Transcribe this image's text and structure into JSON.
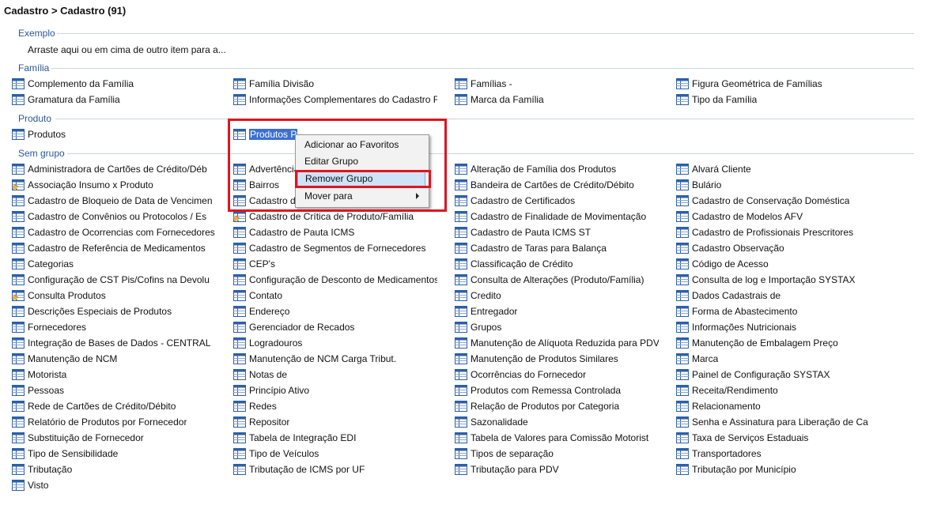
{
  "title": "Cadastro > Cadastro (91)",
  "colors": {
    "group": "#2b5797",
    "icon": "#2e5fa8",
    "selection": "#3a6fcf",
    "annotation": "#e0141e"
  },
  "groups": {
    "exemplo": "Exemplo",
    "familia": "Família",
    "produto": "Produto",
    "sem_grupo": "Sem grupo"
  },
  "hint": "Arraste aqui ou em cima de outro item para a...",
  "familia_items": [
    {
      "label": "Complemento da Família",
      "icon": "table-icon"
    },
    {
      "label": "Família Divisão",
      "icon": "table-icon"
    },
    {
      "label": "Famílias -",
      "icon": "table-icon"
    },
    {
      "label": "Figura Geométrica de Famílias",
      "icon": "table-icon"
    },
    {
      "label": "Gramatura da Família",
      "icon": "table-icon"
    },
    {
      "label": "Informações Complementares do Cadastro F",
      "icon": "table-icon"
    },
    {
      "label": "Marca da Família",
      "icon": "table-icon"
    },
    {
      "label": "Tipo da Família",
      "icon": "table-icon"
    }
  ],
  "produto_items": [
    {
      "label": "Produtos",
      "icon": "table-icon"
    },
    {
      "label": "Produtos P",
      "icon": "table-icon",
      "selected": true
    }
  ],
  "sem_grupo_items": [
    {
      "label": "Administradora de Cartões de Crédito/Déb",
      "icon": "table-icon"
    },
    {
      "label": "Advertência",
      "icon": "table-icon"
    },
    {
      "label": "Alteração de Família dos Produtos",
      "icon": "table-icon"
    },
    {
      "label": "Alvará Cliente",
      "icon": "table-icon"
    },
    {
      "label": "Associação Insumo x Produto",
      "icon": "table-star-icon"
    },
    {
      "label": "Bairros",
      "icon": "table-icon"
    },
    {
      "label": "Bandeira de Cartões de Crédito/Débito",
      "icon": "table-icon"
    },
    {
      "label": "Bulário",
      "icon": "table-icon"
    },
    {
      "label": "Cadastro de Bloqueio de Data de Vencimen",
      "icon": "table-icon"
    },
    {
      "label": "Cadastro de",
      "icon": "table-icon"
    },
    {
      "label": "Cadastro de Certificados",
      "icon": "table-icon"
    },
    {
      "label": "Cadastro de Conservação Doméstica",
      "icon": "table-icon"
    },
    {
      "label": "Cadastro de Convênios ou Protocolos / Es",
      "icon": "table-icon"
    },
    {
      "label": "Cadastro de Crítica de Produto/Família",
      "icon": "table-star-icon"
    },
    {
      "label": "Cadastro de Finalidade de Movimentação",
      "icon": "table-icon"
    },
    {
      "label": "Cadastro de Modelos AFV",
      "icon": "table-icon"
    },
    {
      "label": "Cadastro de Ocorrencias com Fornecedores",
      "icon": "table-icon"
    },
    {
      "label": "Cadastro de Pauta ICMS",
      "icon": "table-icon"
    },
    {
      "label": "Cadastro de Pauta ICMS ST",
      "icon": "table-icon"
    },
    {
      "label": "Cadastro de Profissionais Prescritores",
      "icon": "table-icon"
    },
    {
      "label": "Cadastro de Referência de Medicamentos",
      "icon": "table-icon"
    },
    {
      "label": "Cadastro de Segmentos de Fornecedores",
      "icon": "table-icon"
    },
    {
      "label": "Cadastro de Taras para Balança",
      "icon": "table-icon"
    },
    {
      "label": "Cadastro Observação",
      "icon": "table-icon"
    },
    {
      "label": "Categorias",
      "icon": "table-icon"
    },
    {
      "label": "CEP's",
      "icon": "table-icon"
    },
    {
      "label": "Classificação de Crédito",
      "icon": "table-icon"
    },
    {
      "label": "Código de Acesso",
      "icon": "table-icon"
    },
    {
      "label": "Configuração de CST Pis/Cofins na Devolu",
      "icon": "table-icon"
    },
    {
      "label": "Configuração de Desconto de Medicamentos",
      "icon": "table-icon"
    },
    {
      "label": "Consulta de Alterações (Produto/Família)",
      "icon": "table-icon"
    },
    {
      "label": "Consulta de log e Importação SYSTAX",
      "icon": "table-icon"
    },
    {
      "label": "Consulta Produtos",
      "icon": "table-star-icon"
    },
    {
      "label": "Contato",
      "icon": "table-icon"
    },
    {
      "label": "Credito",
      "icon": "table-icon"
    },
    {
      "label": "Dados Cadastrais de",
      "icon": "table-icon"
    },
    {
      "label": "Descrições Especiais de Produtos",
      "icon": "table-icon"
    },
    {
      "label": "Endereço",
      "icon": "table-icon"
    },
    {
      "label": "Entregador",
      "icon": "table-icon"
    },
    {
      "label": "Forma de Abastecimento",
      "icon": "table-icon"
    },
    {
      "label": "Fornecedores",
      "icon": "table-icon"
    },
    {
      "label": "Gerenciador de Recados",
      "icon": "table-icon"
    },
    {
      "label": "Grupos",
      "icon": "table-icon"
    },
    {
      "label": "Informações Nutricionais",
      "icon": "table-icon"
    },
    {
      "label": "Integração de Bases de Dados - CENTRAL",
      "icon": "table-icon"
    },
    {
      "label": "Logradouros",
      "icon": "table-icon"
    },
    {
      "label": "Manutenção de Alíquota Reduzida para PDV",
      "icon": "table-icon"
    },
    {
      "label": "Manutenção de Embalagem Preço",
      "icon": "table-icon"
    },
    {
      "label": "Manutenção de NCM",
      "icon": "table-icon"
    },
    {
      "label": "Manutenção de NCM Carga Tribut.",
      "icon": "table-icon"
    },
    {
      "label": "Manutenção de Produtos Similares",
      "icon": "table-icon"
    },
    {
      "label": "Marca",
      "icon": "table-icon"
    },
    {
      "label": "Motorista",
      "icon": "table-icon"
    },
    {
      "label": "Notas de",
      "icon": "table-icon"
    },
    {
      "label": "Ocorrências do Fornecedor",
      "icon": "table-icon"
    },
    {
      "label": "Painel de Configuração SYSTAX",
      "icon": "table-icon"
    },
    {
      "label": "Pessoas",
      "icon": "table-icon"
    },
    {
      "label": "Princípio Ativo",
      "icon": "table-icon"
    },
    {
      "label": "Produtos com Remessa Controlada",
      "icon": "table-icon"
    },
    {
      "label": "Receita/Rendimento",
      "icon": "table-icon"
    },
    {
      "label": "Rede de Cartões de Crédito/Débito",
      "icon": "table-icon"
    },
    {
      "label": "Redes",
      "icon": "table-icon"
    },
    {
      "label": "Relação de Produtos por Categoria",
      "icon": "table-icon"
    },
    {
      "label": "Relacionamento",
      "icon": "table-icon"
    },
    {
      "label": "Relatório de Produtos por Fornecedor",
      "icon": "table-icon"
    },
    {
      "label": "Repositor",
      "icon": "table-icon"
    },
    {
      "label": "Sazonalidade",
      "icon": "table-icon"
    },
    {
      "label": "Senha e  Assinatura para Liberação de Ca",
      "icon": "table-icon"
    },
    {
      "label": "Substituição de Fornecedor",
      "icon": "table-icon"
    },
    {
      "label": "Tabela de Integração EDI",
      "icon": "table-icon"
    },
    {
      "label": "Tabela de Valores para Comissão Motorist",
      "icon": "table-icon"
    },
    {
      "label": "Taxa de Serviços Estaduais",
      "icon": "table-icon"
    },
    {
      "label": "Tipo de Sensibilidade",
      "icon": "table-icon"
    },
    {
      "label": "Tipo de Veículos",
      "icon": "table-icon"
    },
    {
      "label": "Tipos de separação",
      "icon": "table-icon"
    },
    {
      "label": "Transportadores",
      "icon": "table-icon"
    },
    {
      "label": "Tributação",
      "icon": "table-icon"
    },
    {
      "label": "Tributação de ICMS por UF",
      "icon": "table-icon"
    },
    {
      "label": "Tributação para PDV",
      "icon": "table-icon"
    },
    {
      "label": "Tributação por Município",
      "icon": "table-icon"
    },
    {
      "label": "Visto",
      "icon": "table-icon"
    }
  ],
  "context_menu": {
    "items": [
      {
        "label": "Adicionar ao Favoritos"
      },
      {
        "label": "Editar Grupo"
      },
      {
        "label": "Remover Grupo",
        "highlighted": true
      },
      {
        "label": "Mover para",
        "submenu": true
      }
    ]
  }
}
